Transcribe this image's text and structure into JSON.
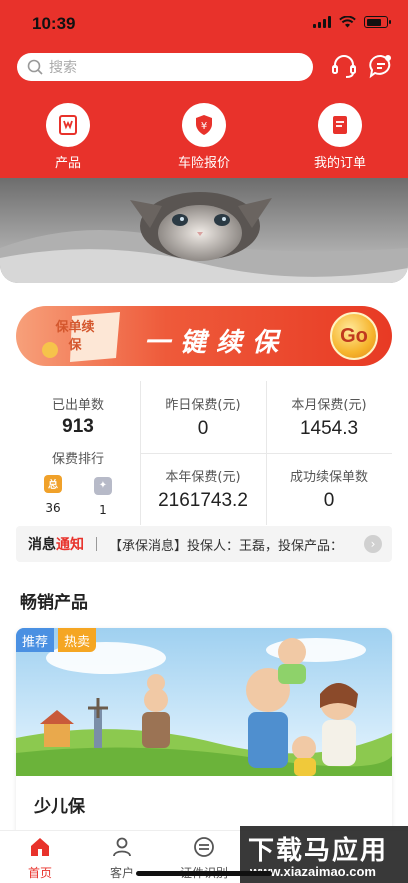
{
  "status_bar": {
    "time": "10:39",
    "battery_level": 0.8
  },
  "search": {
    "placeholder": "搜索"
  },
  "header_icons": [
    "headset-icon",
    "chat-bubble-icon"
  ],
  "quick_nav": [
    {
      "label": "产品",
      "icon": "product-icon"
    },
    {
      "label": "车险报价",
      "icon": "shield-yen-icon"
    },
    {
      "label": "我的订单",
      "icon": "order-list-icon"
    }
  ],
  "renew_banner": {
    "badge": "保单续保",
    "title": "一键续保",
    "go": "Go"
  },
  "stats": {
    "orders_label": "已出单数",
    "orders_value": "913",
    "rank_label": "保费排行",
    "rank_gold_badge": "总",
    "rank_gold_value": "36",
    "rank_silver_value": "1",
    "yesterday_label": "昨日保费(元)",
    "yesterday_value": "0",
    "month_label": "本月保费(元)",
    "month_value": "1454.3",
    "year_label": "本年保费(元)",
    "year_value": "2161743.2",
    "renewed_label": "成功续保单数",
    "renewed_value": "0"
  },
  "notice": {
    "title_a": "消息",
    "title_b": "通知",
    "text": "【承保消息】投保人：王磊，投保产品：..."
  },
  "section_title": "畅销产品",
  "product": {
    "tag_recommend": "推荐",
    "tag_hot": "热卖",
    "name": "少儿保"
  },
  "tabbar": [
    {
      "label": "首页",
      "icon": "home-icon",
      "active": true
    },
    {
      "label": "客户",
      "icon": "user-icon",
      "active": false
    },
    {
      "label": "证件识别",
      "icon": "scan-id-icon",
      "active": false
    }
  ],
  "watermark": {
    "title": "下载马应用",
    "url": "www.xiazaimao.com"
  },
  "colors": {
    "brand_red": "#e8322b",
    "tag_blue": "#4a90e2",
    "tag_orange": "#f5a623"
  }
}
